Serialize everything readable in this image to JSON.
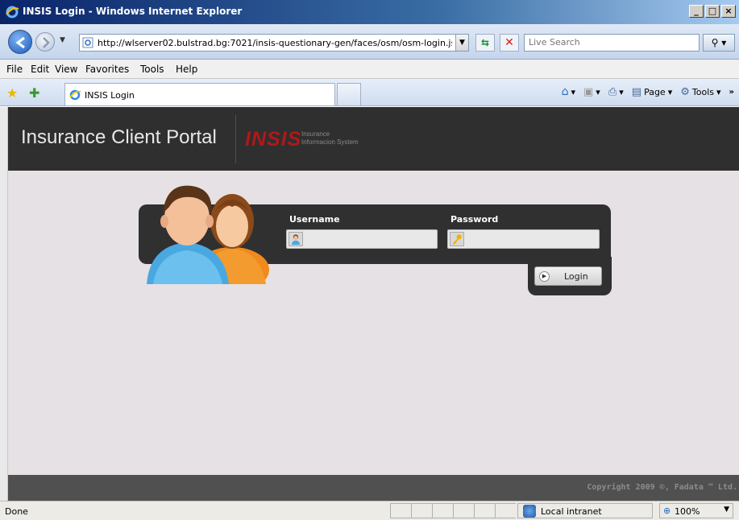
{
  "window": {
    "title": "INSIS Login - Windows Internet Explorer"
  },
  "address_bar": {
    "url": "http://wlserver02.bulstrad.bg:7021/insis-questionary-gen/faces/osm/osm-login.js",
    "search_placeholder": "Live Search"
  },
  "menu": {
    "items": [
      "File",
      "Edit",
      "View",
      "Favorites",
      "Tools",
      "Help"
    ]
  },
  "tabs": {
    "active_label": "INSIS Login"
  },
  "command_bar": {
    "page_label": "Page",
    "tools_label": "Tools"
  },
  "portal": {
    "title": "Insurance Client Portal",
    "logo": "INSIS",
    "logo_sub_line1": "Insurance",
    "logo_sub_line2": "Informacion System",
    "username_label": "Username",
    "password_label": "Password",
    "username_value": "",
    "password_value": "",
    "login_label": "Login",
    "copyright": "Copyright 2009 ©, Fadata ™ Ltd."
  },
  "status_bar": {
    "text": "Done",
    "zone": "Local intranet",
    "zoom": "100%"
  },
  "colors": {
    "header_bg": "#2f2f2f",
    "logo_red": "#b01818",
    "page_bg": "#e6e1e4"
  }
}
